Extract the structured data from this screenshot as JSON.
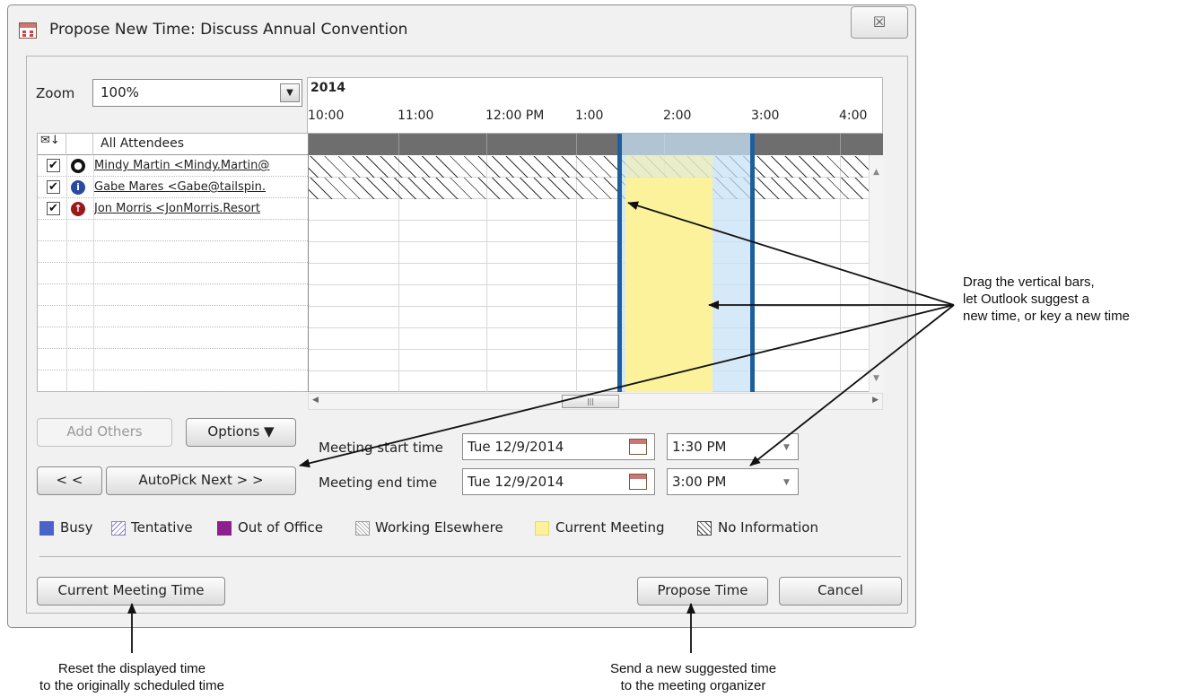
{
  "window": {
    "title": "Propose New Time:  Discuss Annual Convention",
    "close_glyph": "☒"
  },
  "zoom": {
    "label": "Zoom",
    "value": "100%"
  },
  "timeline": {
    "year": "2014",
    "hours": [
      "10:00",
      "11:00",
      "12:00 PM",
      "1:00",
      "2:00",
      "3:00",
      "4:00"
    ]
  },
  "attendees": {
    "header": "All Attendees",
    "rows": [
      {
        "checked": true,
        "status": "organizer",
        "name": "Mindy Martin <Mindy.Martin@"
      },
      {
        "checked": true,
        "status": "optional",
        "name": "Gabe Mares <Gabe@tailspin."
      },
      {
        "checked": true,
        "status": "required",
        "name": "Jon Morris <JonMorris.Resort"
      }
    ]
  },
  "buttons": {
    "add_others": "Add Others",
    "options": "Options ▼",
    "prev": "< <",
    "autopick_next": "AutoPick Next > >",
    "current_meeting_time": "Current Meeting Time",
    "propose_time": "Propose Time",
    "cancel": "Cancel"
  },
  "meeting": {
    "start_label": "Meeting start time",
    "start_date": "Tue 12/9/2014",
    "start_time": "1:30 PM",
    "end_label": "Meeting end time",
    "end_date": "Tue 12/9/2014",
    "end_time": "3:00 PM"
  },
  "legend": [
    {
      "label": "Busy",
      "color": "#4a63c8"
    },
    {
      "label": "Tentative",
      "color": "#8b7fd1"
    },
    {
      "label": "Out of Office",
      "color": "#8e1f8e"
    },
    {
      "label": "Working Elsewhere",
      "color": "#999999"
    },
    {
      "label": "Current Meeting",
      "color": "#fdf29c"
    },
    {
      "label": "No Information",
      "color": "#444444"
    }
  ],
  "callouts": {
    "drag_line1": "Drag the vertical bars,",
    "drag_line2": "let Outlook suggest a",
    "drag_line3": "new time, or key a new time",
    "reset_line1": "Reset the displayed time",
    "reset_line2": "to the originally scheduled time",
    "send_line1": "Send a new suggested time",
    "send_line2": "to the meeting organizer"
  }
}
